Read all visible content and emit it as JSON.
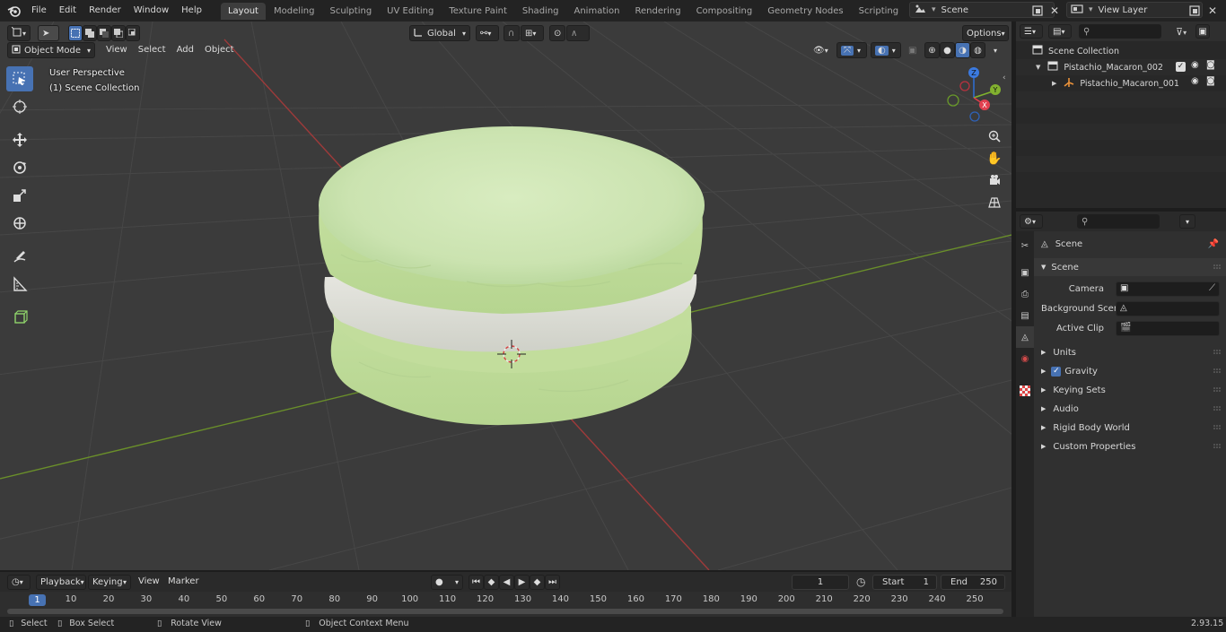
{
  "topbar": {
    "menus": [
      "File",
      "Edit",
      "Render",
      "Window",
      "Help"
    ],
    "workspaces": [
      "Layout",
      "Modeling",
      "Sculpting",
      "UV Editing",
      "Texture Paint",
      "Shading",
      "Animation",
      "Rendering",
      "Compositing",
      "Geometry Nodes",
      "Scripting"
    ],
    "active_workspace": "Layout",
    "scene_name": "Scene",
    "view_layer_name": "View Layer"
  },
  "viewport": {
    "mode": "Object Mode",
    "menus": [
      "View",
      "Select",
      "Add",
      "Object"
    ],
    "transform_orientation": "Global",
    "options_label": "Options",
    "perspective_label": "User Perspective",
    "collection_label": "(1) Scene Collection"
  },
  "outliner": {
    "root": "Scene Collection",
    "items": [
      {
        "label": "Pistachio_Macaron_002"
      },
      {
        "label": "Pistachio_Macaron_001"
      }
    ]
  },
  "properties": {
    "context_title": "Scene",
    "panel_title": "Scene",
    "camera_label": "Camera",
    "background_scene_label": "Background Scene",
    "active_clip_label": "Active Clip",
    "sections": [
      "Units",
      "Gravity",
      "Keying Sets",
      "Audio",
      "Rigid Body World",
      "Custom Properties"
    ]
  },
  "timeline": {
    "menus": [
      "Playback",
      "Keying",
      "View",
      "Marker"
    ],
    "current_frame": "1",
    "start_label": "Start",
    "start_value": "1",
    "end_label": "End",
    "end_value": "250",
    "ruler_current": "1",
    "ruler_ticks": [
      "10",
      "20",
      "30",
      "40",
      "50",
      "60",
      "70",
      "80",
      "90",
      "100",
      "110",
      "120",
      "130",
      "140",
      "150",
      "160",
      "170",
      "180",
      "190",
      "200",
      "210",
      "220",
      "230",
      "240",
      "250"
    ]
  },
  "statusbar": {
    "select": "Select",
    "box_select": "Box Select",
    "rotate_view": "Rotate View",
    "context_menu": "Object Context Menu",
    "version": "2.93.15"
  },
  "colors": {
    "accent": "#4772b3",
    "axis_x": "#9e3a3a",
    "axis_y": "#6a8f2a",
    "macaron_shell": "#cde5b2",
    "macaron_filling": "#e2e2dc"
  }
}
